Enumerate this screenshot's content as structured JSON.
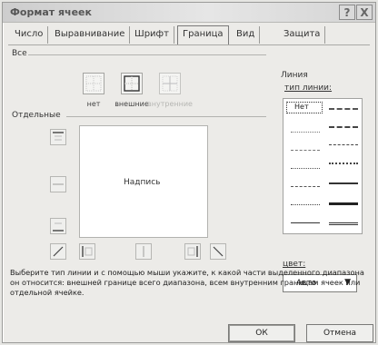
{
  "window": {
    "title": "Формат ячеек",
    "help_label": "?",
    "close_label": "X"
  },
  "tabs": [
    {
      "label": "Число"
    },
    {
      "label": "Выравнивание"
    },
    {
      "label": "Шрифт"
    },
    {
      "label": "Граница",
      "active": true
    },
    {
      "label": "Вид"
    },
    {
      "label": "Защита"
    }
  ],
  "border_tab": {
    "all_label": "Все",
    "presets": [
      {
        "label": "нет",
        "icon": "border-none-icon",
        "enabled": true
      },
      {
        "label": "внешние",
        "icon": "border-outer-icon",
        "enabled": true
      },
      {
        "label": "внутренние",
        "icon": "border-inner-icon",
        "enabled": false
      }
    ],
    "separate_label": "Отдельные",
    "preview_text": "Надпись",
    "line_group_label": "Линия",
    "line_type_label": "тип линии:",
    "line_none_label": "Нет",
    "color_label": "цвет:",
    "color_value": "Авто",
    "instructions": "Выберите тип линии и с помощью мыши укажите, к какой части выделенного диапазона он относится: внешней границе всего диапазона, всем внутренним границам ячеек или отдельной ячейке."
  },
  "buttons": {
    "ok": "ОК",
    "cancel": "Отмена"
  }
}
